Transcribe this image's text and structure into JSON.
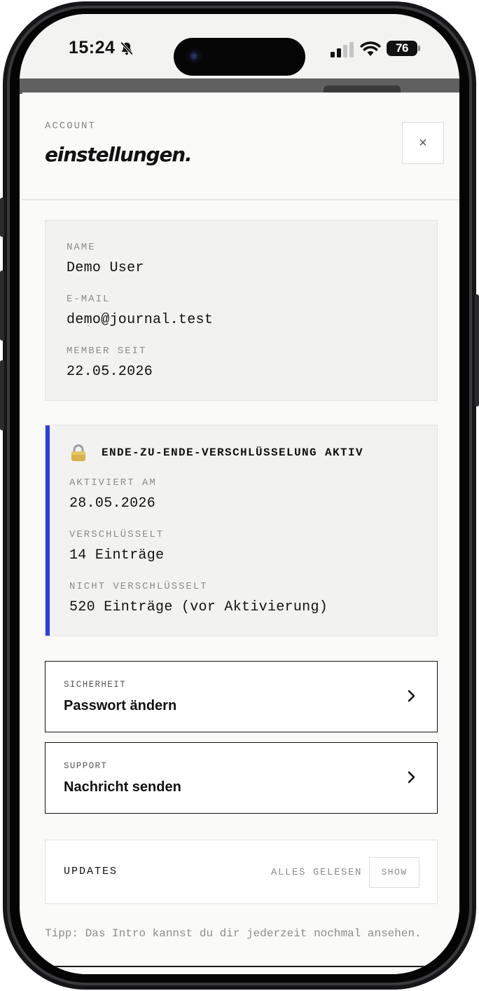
{
  "status_bar": {
    "time": "15:24",
    "battery": "76",
    "icons": [
      "bell-slash-icon",
      "cellular-signal-icon",
      "wifi-icon",
      "battery-icon"
    ]
  },
  "header": {
    "eyebrow": "ACCOUNT",
    "title": "einstellungen.",
    "close_label": "×"
  },
  "profile": {
    "name_label": "NAME",
    "name_value": "Demo User",
    "email_label": "E-MAIL",
    "email_value": "demo@journal.test",
    "member_label": "MEMBER SEIT",
    "member_value": "22.05.2026"
  },
  "encryption": {
    "icon": "lock-icon",
    "title": "ENDE-ZU-ENDE-VERSCHLÜSSELUNG AKTIV",
    "activated_label": "AKTIVIERT AM",
    "activated_value": "28.05.2026",
    "encrypted_label": "VERSCHLÜSSELT",
    "encrypted_value": "14 Einträge",
    "unencrypted_label": "NICHT VERSCHLÜSSELT",
    "unencrypted_value": "520 Einträge (vor Aktivierung)",
    "accent_color": "#2b3ee6"
  },
  "nav_items": [
    {
      "label": "SICHERHEIT",
      "text": "Passwort ändern"
    },
    {
      "label": "SUPPORT",
      "text": "Nachricht senden"
    }
  ],
  "updates": {
    "label": "UPDATES",
    "status": "ALLES GELESEN",
    "button": "SHOW"
  },
  "tip": "Tipp: Das Intro kannst du dir jederzeit nochmal ansehen."
}
